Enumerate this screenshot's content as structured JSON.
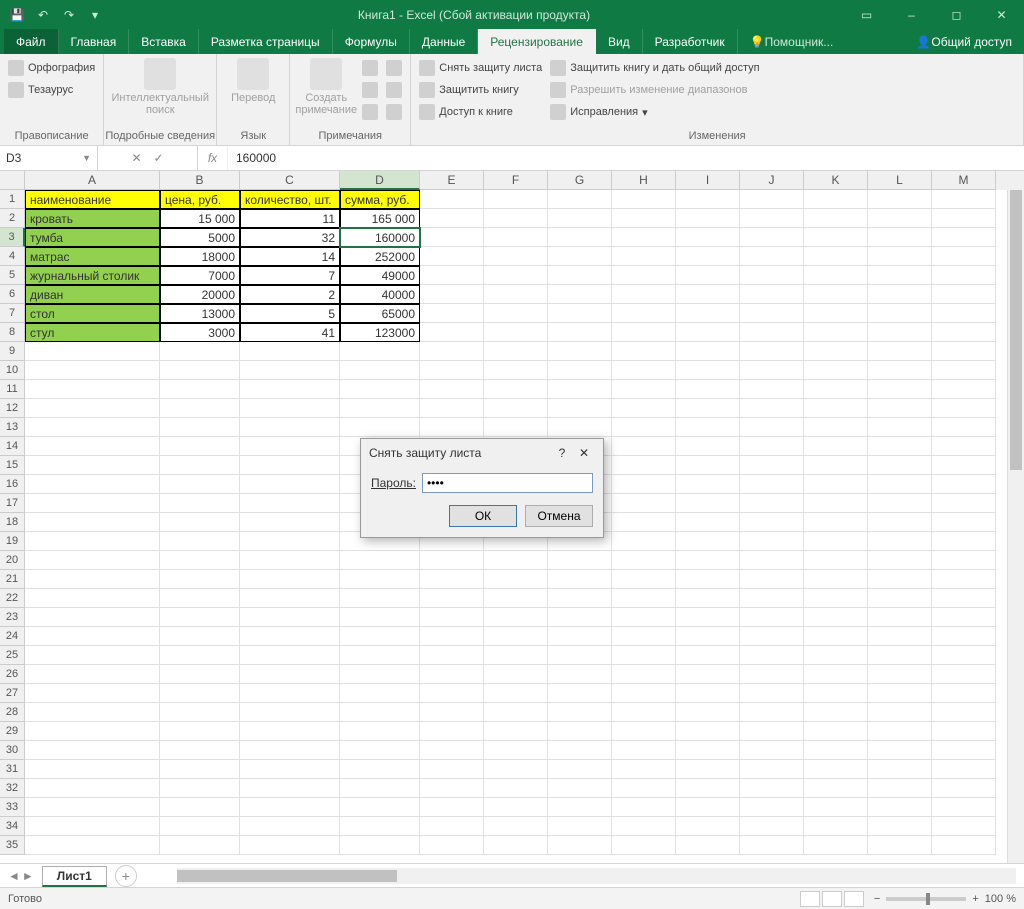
{
  "title": "Книга1 - Excel (Сбой активации продукта)",
  "tabs": {
    "file": "Файл",
    "home": "Главная",
    "insert": "Вставка",
    "layout": "Разметка страницы",
    "formulas": "Формулы",
    "data": "Данные",
    "review": "Рецензирование",
    "view": "Вид",
    "developer": "Разработчик",
    "help": "Помощник...",
    "share": "Общий доступ"
  },
  "ribbon": {
    "spelling": "Орфография",
    "thesaurus": "Тезаурус",
    "group_proofing": "Правописание",
    "smart_lookup": "Интеллектуальный поиск",
    "group_insights": "Подробные сведения",
    "translate": "Перевод",
    "group_language": "Язык",
    "new_comment": "Создать примечание",
    "group_comments": "Примечания",
    "unprotect_sheet": "Снять защиту листа",
    "protect_workbook": "Защитить книгу",
    "share_workbook": "Доступ к книге",
    "protect_share": "Защитить книгу и дать общий доступ",
    "allow_ranges": "Разрешить изменение диапазонов",
    "track_changes": "Исправления",
    "group_changes": "Изменения"
  },
  "namebox": "D3",
  "formula": "160000",
  "columns": [
    "A",
    "B",
    "C",
    "D",
    "E",
    "F",
    "G",
    "H",
    "I",
    "J",
    "K",
    "L",
    "M"
  ],
  "headers": {
    "A": "наименование",
    "B": "цена, руб.",
    "C": "количество, шт.",
    "D": "сумма, руб."
  },
  "rows": [
    {
      "A": "кровать",
      "B": "15 000",
      "C": "11",
      "D": "165 000"
    },
    {
      "A": "тумба",
      "B": "5000",
      "C": "32",
      "D": "160000"
    },
    {
      "A": "матрас",
      "B": "18000",
      "C": "14",
      "D": "252000"
    },
    {
      "A": "журнальный столик",
      "B": "7000",
      "C": "7",
      "D": "49000"
    },
    {
      "A": "диван",
      "B": "20000",
      "C": "2",
      "D": "40000"
    },
    {
      "A": "стол",
      "B": "13000",
      "C": "5",
      "D": "65000"
    },
    {
      "A": "стул",
      "B": "3000",
      "C": "41",
      "D": "123000"
    }
  ],
  "dialog": {
    "title": "Снять защиту листа",
    "password_label": "Пароль:",
    "password_value": "••••",
    "ok": "ОК",
    "cancel": "Отмена"
  },
  "sheet": {
    "name": "Лист1"
  },
  "status": {
    "ready": "Готово",
    "zoom": "100 %"
  }
}
